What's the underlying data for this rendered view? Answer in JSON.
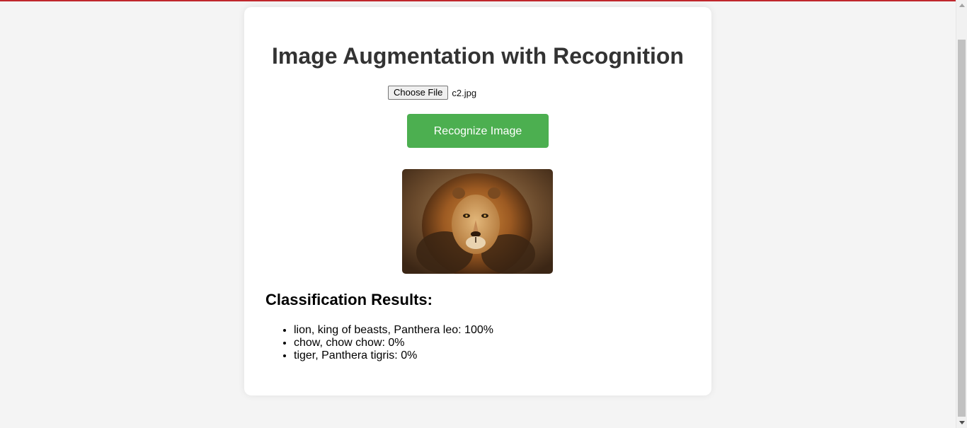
{
  "page": {
    "title": "Image Augmentation with Recognition"
  },
  "file_input": {
    "button_label": "Choose File",
    "file_name": "c2.jpg"
  },
  "recognize_button": {
    "label": "Recognize Image"
  },
  "preview": {
    "icon": "lion-photo"
  },
  "results": {
    "heading": "Classification Results:",
    "items": [
      "lion, king of beasts, Panthera leo: 100%",
      "chow, chow chow: 0%",
      "tiger, Panthera tigris: 0%"
    ]
  },
  "colors": {
    "accent": "#4caf50",
    "top_bar": "#c0272d",
    "title": "#333333",
    "background": "#f4f4f4"
  }
}
